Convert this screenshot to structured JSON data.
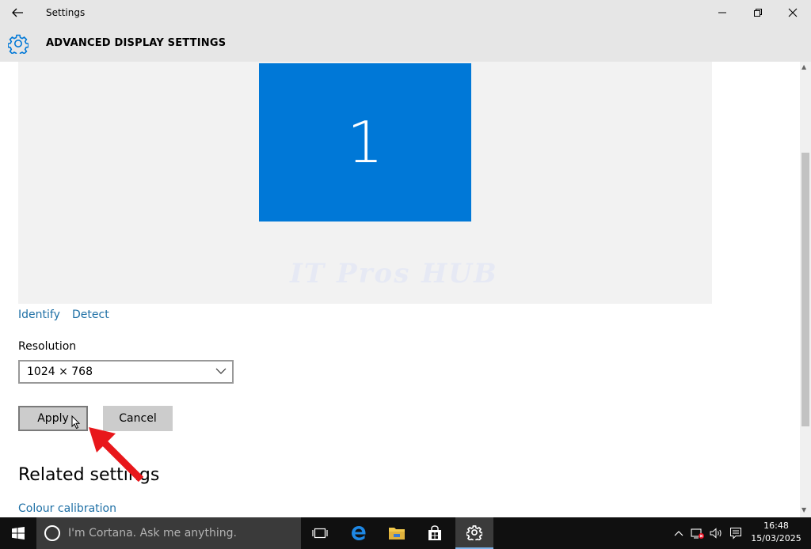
{
  "window": {
    "title": "Settings",
    "back_icon": "back-arrow-icon",
    "controls": [
      "minimize-icon",
      "maximize-icon",
      "close-icon"
    ]
  },
  "header": {
    "icon": "gear-icon",
    "title": "ADVANCED DISPLAY SETTINGS"
  },
  "display_preview": {
    "monitor_label": "1",
    "watermark": "IT Pros HUB",
    "monitor_color": "#0078d7"
  },
  "links": {
    "identify": "Identify",
    "detect": "Detect"
  },
  "resolution": {
    "label": "Resolution",
    "value": "1024 × 768"
  },
  "buttons": {
    "apply": "Apply",
    "cancel": "Cancel"
  },
  "related": {
    "heading": "Related settings",
    "colour_calibration": "Colour calibration"
  },
  "taskbar": {
    "search_placeholder": "I'm Cortana. Ask me anything.",
    "apps": [
      "task-view-icon",
      "edge-icon",
      "file-explorer-icon",
      "store-icon",
      "settings-icon"
    ],
    "time": "16:48",
    "date": "15/03/2025"
  },
  "colors": {
    "accent": "#0078d7",
    "link": "#1d6fa5",
    "annotation_arrow": "#e8171b"
  }
}
